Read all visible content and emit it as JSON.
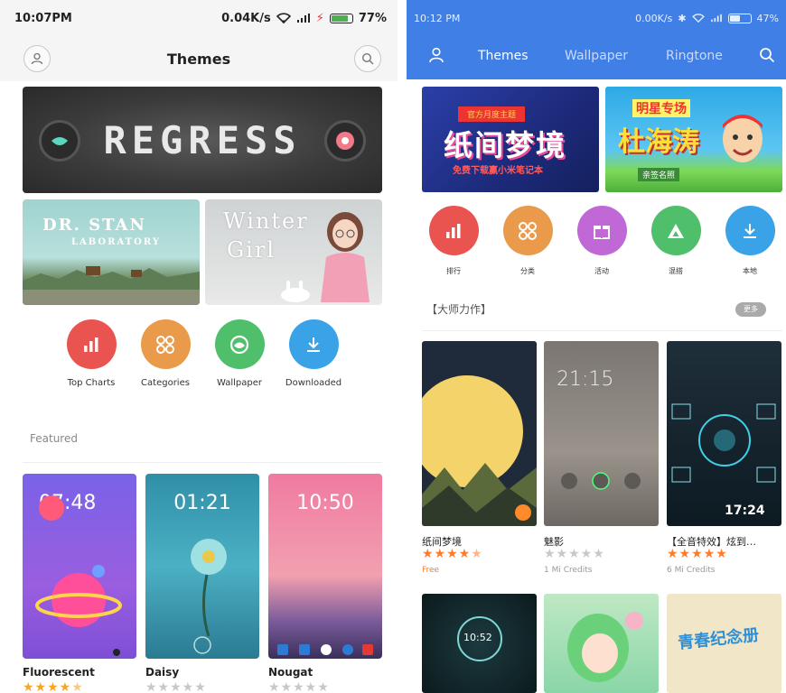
{
  "left": {
    "status": {
      "time": "10:07PM",
      "speed": "0.04K/s",
      "battery": "77%"
    },
    "header": {
      "title": "Themes"
    },
    "hero": {
      "text": "REGRESS"
    },
    "tiles": [
      {
        "line1": "DR. STAN",
        "line2": "LABORATORY"
      },
      {
        "line1": "Winter",
        "line2": "Girl"
      }
    ],
    "categories": [
      {
        "label": "Top Charts",
        "color": "#e95450"
      },
      {
        "label": "Categories",
        "color": "#e99a4a"
      },
      {
        "label": "Wallpaper",
        "color": "#4fbf6b"
      },
      {
        "label": "Downloaded",
        "color": "#3aa3e8"
      }
    ],
    "section": "Featured",
    "cards": [
      {
        "title": "Fluorescent",
        "clock": "07:48",
        "rating": 4.5
      },
      {
        "title": "Daisy",
        "clock": "01:21",
        "rating": 0
      },
      {
        "title": "Nougat",
        "clock": "10:50",
        "rating": 0
      }
    ]
  },
  "right": {
    "status": {
      "time": "10:12 PM",
      "speed": "0.00K/s",
      "battery": "47%"
    },
    "tabs": [
      "Themes",
      "Wallpaper",
      "Ringtone"
    ],
    "banners": [
      {
        "ribbon": "官方月度主题",
        "big": "纸间梦境",
        "small": "免费下载赢小米笔记本"
      },
      {
        "top": "明星专场",
        "big": "杜海涛",
        "small": "亲签名照"
      }
    ],
    "categories": [
      {
        "label": "排行",
        "color": "#e95450"
      },
      {
        "label": "分类",
        "color": "#e99a4a"
      },
      {
        "label": "活动",
        "color": "#c068d6"
      },
      {
        "label": "混搭",
        "color": "#4fbf6b"
      },
      {
        "label": "本地",
        "color": "#3aa3e8"
      }
    ],
    "section": "【大师力作】",
    "more": "更多",
    "items": [
      {
        "title": "纸间梦境",
        "rating": 4.5,
        "price": "Free"
      },
      {
        "title": "魅影",
        "rating": 0,
        "price": "1 Mi Credits"
      },
      {
        "title": "【全音特效】炫到…",
        "rating": 5,
        "price": "6 Mi Credits"
      }
    ],
    "thumb_clock": "21:15",
    "thumb3_clock": "17:24",
    "row2_clock": "10:52",
    "row2_text": "青春纪念册"
  }
}
